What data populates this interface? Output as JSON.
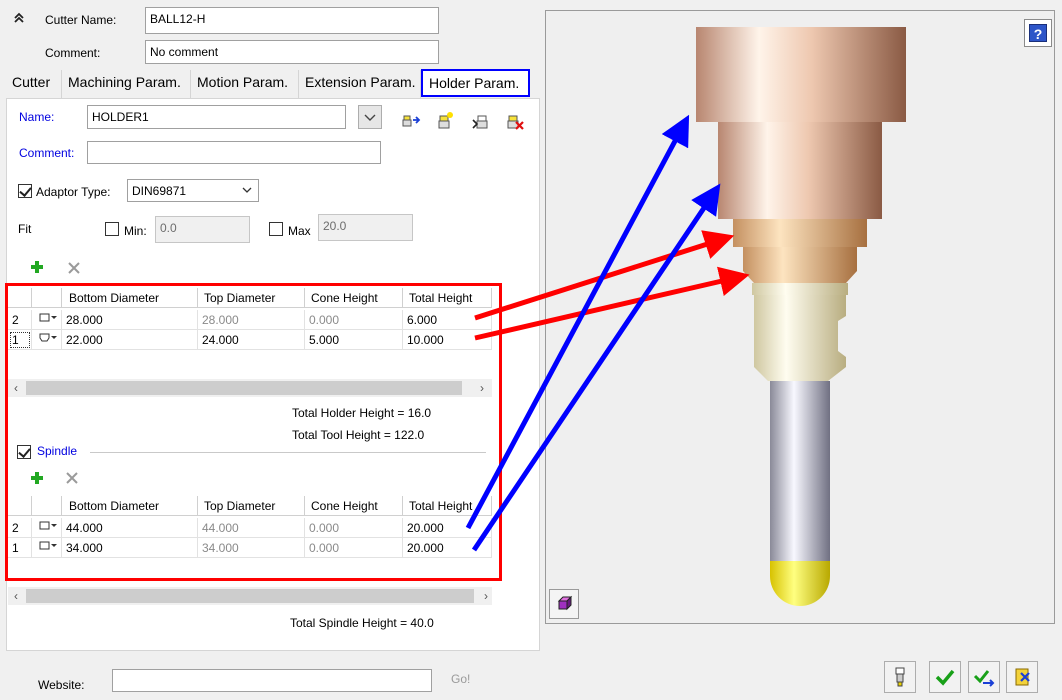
{
  "header": {
    "cutter_name_label": "Cutter Name:",
    "cutter_name_value": "BALL12-H",
    "comment_label": "Comment:",
    "comment_value": "No comment"
  },
  "tabs": [
    {
      "label": "Cutter"
    },
    {
      "label": "Machining Param."
    },
    {
      "label": "Motion Param."
    },
    {
      "label": "Extension Param."
    },
    {
      "label": "Holder Param.",
      "active": true
    }
  ],
  "holder": {
    "name_label": "Name:",
    "name_value": "HOLDER1",
    "comment_label": "Comment:",
    "comment_value": "",
    "adaptor_label": "Adaptor Type:",
    "adaptor_value": "DIN69871",
    "fit_label": "Fit",
    "min_label": "Min:",
    "min_value": "0.0",
    "max_label": "Max",
    "max_value": "20.0",
    "columns": [
      "Bottom Diameter",
      "Top Diameter",
      "Cone Height",
      "Total Height"
    ],
    "rows": [
      {
        "index": "2",
        "bottom": "28.000",
        "top": "28.000",
        "cone": "0.000",
        "total": "6.000"
      },
      {
        "index": "1",
        "bottom": "22.000",
        "top": "24.000",
        "cone": "5.000",
        "total": "10.000"
      }
    ],
    "total_holder_height": "Total Holder Height = 16.0",
    "total_tool_height": "Total Tool Height = 122.0"
  },
  "spindle": {
    "label": "Spindle",
    "columns": [
      "Bottom Diameter",
      "Top Diameter",
      "Cone Height",
      "Total Height"
    ],
    "rows": [
      {
        "index": "2",
        "bottom": "44.000",
        "top": "44.000",
        "cone": "0.000",
        "total": "20.000"
      },
      {
        "index": "1",
        "bottom": "34.000",
        "top": "34.000",
        "cone": "0.000",
        "total": "20.000"
      }
    ],
    "total_spindle_height": "Total Spindle Height = 40.0"
  },
  "footer": {
    "website_label": "Website:",
    "website_value": "",
    "go_label": "Go!"
  },
  "help_label": "?",
  "colors": {
    "accent_blue": "#0000ff",
    "annotation_red": "#ff0000",
    "link_blue": "#0000e0",
    "add_green": "#22a822"
  },
  "icons": [
    "collapse-chevrons-icon",
    "dropdown-arrow-icon",
    "holder-import-icon",
    "holder-new-icon",
    "holder-save-icon",
    "holder-delete-icon",
    "add-plus-icon",
    "delete-x-icon",
    "shape-selector-icon",
    "view-cube-icon",
    "help-icon",
    "tool-icon",
    "check-icon",
    "check-arrow-icon",
    "exit-icon"
  ]
}
